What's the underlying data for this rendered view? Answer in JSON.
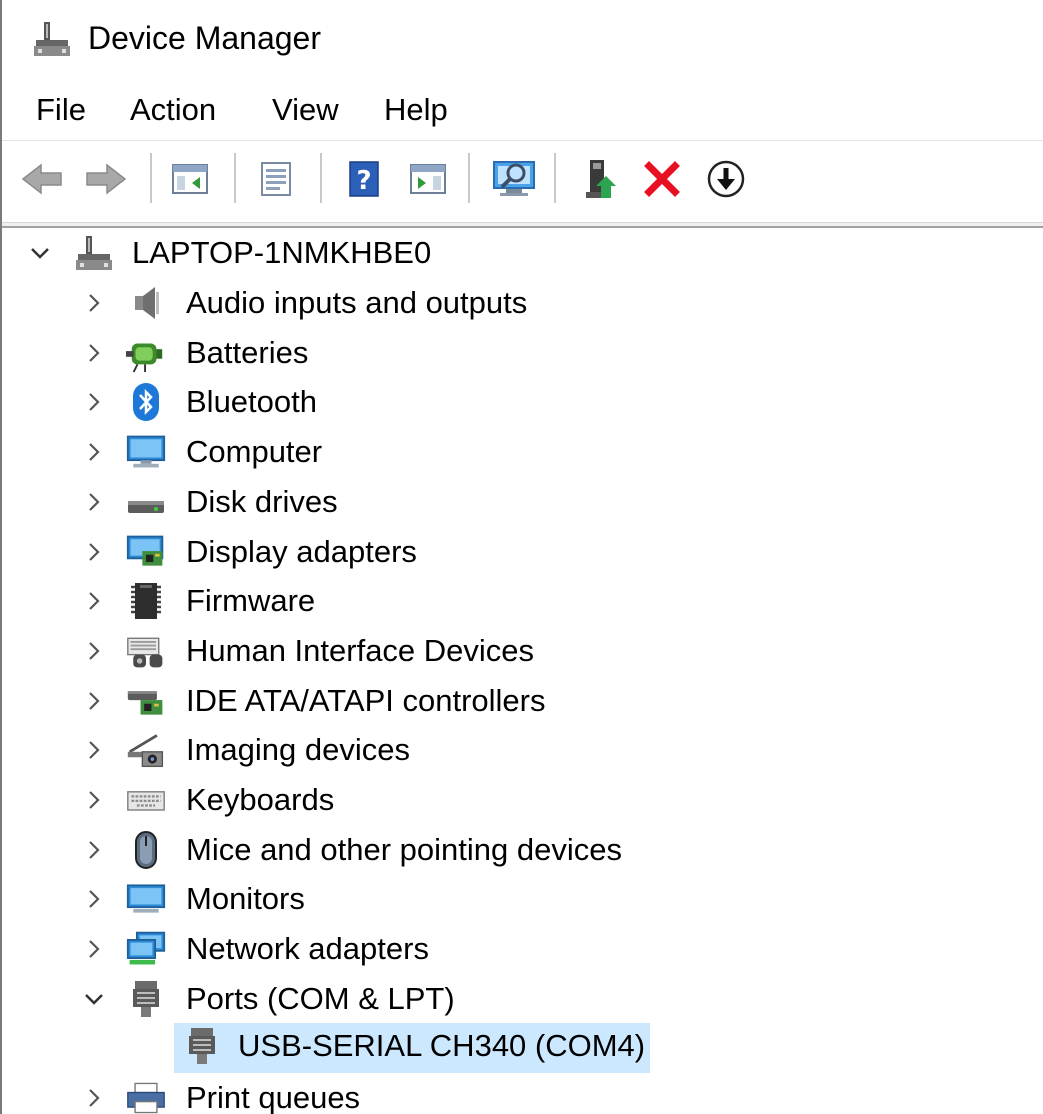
{
  "window": {
    "title": "Device Manager",
    "icon": "device-manager-icon"
  },
  "menu": {
    "file": "File",
    "action": "Action",
    "view": "View",
    "help": "Help"
  },
  "toolbar": {
    "buttons": [
      {
        "name": "back-arrow-icon"
      },
      {
        "name": "forward-arrow-icon"
      },
      {
        "name": "show-hide-console-tree-icon"
      },
      {
        "name": "properties-icon"
      },
      {
        "name": "help-icon"
      },
      {
        "name": "show-hide-action-pane-icon"
      },
      {
        "name": "scan-hardware-changes-icon"
      },
      {
        "name": "update-driver-icon"
      },
      {
        "name": "uninstall-device-icon"
      },
      {
        "name": "disable-device-icon"
      }
    ]
  },
  "tree": {
    "root": {
      "label": "LAPTOP-1NMKHBE0",
      "expanded": true,
      "icon": "computer-tree-icon"
    },
    "categories": [
      {
        "label": "Audio inputs and outputs",
        "icon": "speaker-icon",
        "expanded": false
      },
      {
        "label": "Batteries",
        "icon": "battery-icon",
        "expanded": false
      },
      {
        "label": "Bluetooth",
        "icon": "bluetooth-icon",
        "expanded": false
      },
      {
        "label": "Computer",
        "icon": "monitor-computer-icon",
        "expanded": false
      },
      {
        "label": "Disk drives",
        "icon": "disk-drive-icon",
        "expanded": false
      },
      {
        "label": "Display adapters",
        "icon": "display-adapter-icon",
        "expanded": false
      },
      {
        "label": "Firmware",
        "icon": "firmware-chip-icon",
        "expanded": false
      },
      {
        "label": "Human Interface Devices",
        "icon": "hid-icon",
        "expanded": false
      },
      {
        "label": "IDE ATA/ATAPI controllers",
        "icon": "ide-controller-icon",
        "expanded": false
      },
      {
        "label": "Imaging devices",
        "icon": "camera-icon",
        "expanded": false
      },
      {
        "label": "Keyboards",
        "icon": "keyboard-icon",
        "expanded": false
      },
      {
        "label": "Mice and other pointing devices",
        "icon": "mouse-icon",
        "expanded": false
      },
      {
        "label": "Monitors",
        "icon": "monitor-icon",
        "expanded": false
      },
      {
        "label": "Network adapters",
        "icon": "network-adapter-icon",
        "expanded": false
      },
      {
        "label": "Ports (COM & LPT)",
        "icon": "port-icon",
        "expanded": true
      },
      {
        "label": "Print queues",
        "icon": "printer-icon",
        "expanded": false
      }
    ],
    "ports_children": [
      {
        "label": "USB-SERIAL CH340 (COM4)",
        "icon": "port-icon",
        "selected": true
      }
    ]
  },
  "colors": {
    "selection": "#cce8ff",
    "accent_blue": "#1e78d7",
    "uninstall_red": "#e81123"
  }
}
